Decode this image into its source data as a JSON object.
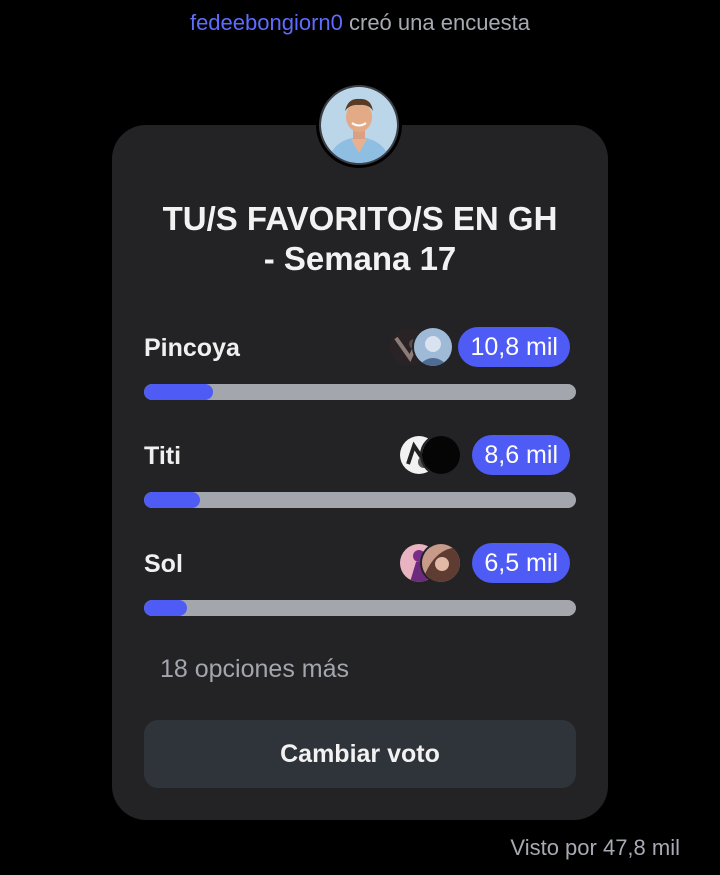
{
  "header": {
    "username": "fedeebongiorn0",
    "action_text": "creó una encuesta"
  },
  "creator_avatar": {
    "icon": "creator-avatar"
  },
  "poll": {
    "title_line1": "TU/S FAVORITO/S EN GH",
    "title_line2": "- Semana 17",
    "options": [
      {
        "label": "Pincoya",
        "count": "10,8 mil",
        "fill_fraction": 0.16,
        "voters": [
          "voter-avatar-dark",
          "voter-avatar-blue"
        ]
      },
      {
        "label": "Titi",
        "count": "8,6 mil",
        "fill_fraction": 0.13,
        "voters": [
          "voter-avatar-white",
          "voter-avatar-black"
        ]
      },
      {
        "label": "Sol",
        "count": "6,5 mil",
        "fill_fraction": 0.1,
        "voters": [
          "voter-avatar-pink",
          "voter-avatar-brown"
        ]
      }
    ],
    "more_options": "18 opciones más",
    "vote_button": "Cambiar voto"
  },
  "footer": {
    "seen_by": "Visto por 47,8 mil"
  },
  "colors": {
    "accent": "#4e5cf5",
    "username": "#5e6bff",
    "card_bg": "#232325",
    "track": "#a4a6ae",
    "button_bg": "#2f333a"
  }
}
